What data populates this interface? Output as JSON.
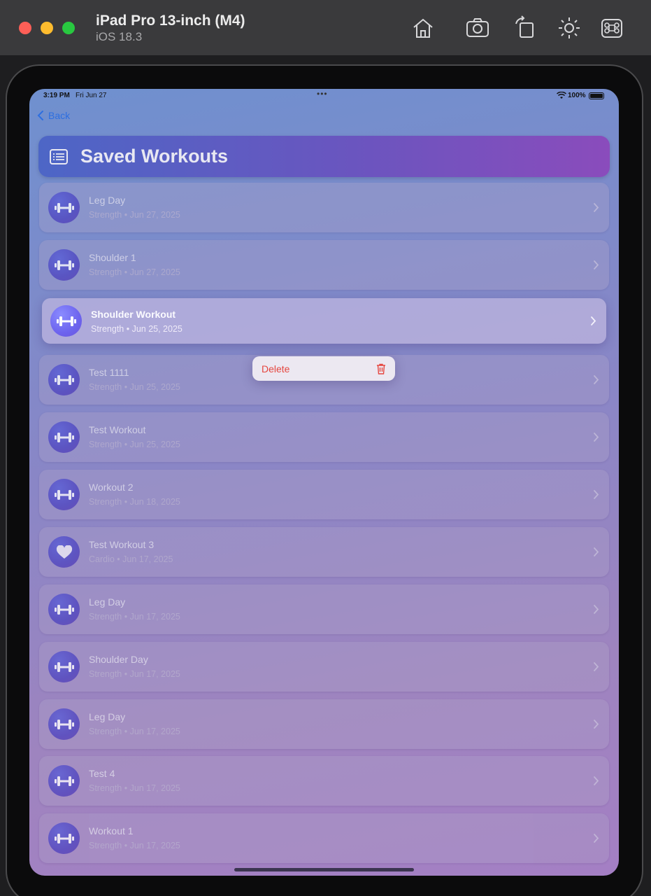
{
  "simulator": {
    "title": "iPad Pro 13-inch (M4)",
    "subtitle": "iOS 18.3",
    "toolbar_icons": [
      "home-icon",
      "screenshot-icon",
      "rotate-icon",
      "appearance-icon",
      "command-icon"
    ]
  },
  "status_bar": {
    "time": "3:19 PM",
    "date": "Fri Jun 27",
    "battery": "100%"
  },
  "nav": {
    "back_label": "Back"
  },
  "header": {
    "title": "Saved Workouts",
    "icon": "list-icon"
  },
  "workouts": [
    {
      "name": "Leg Day",
      "meta": "Strength • Jun 27, 2025",
      "icon": "dumbbell-icon"
    },
    {
      "name": "Shoulder 1",
      "meta": "Strength • Jun 27, 2025",
      "icon": "dumbbell-icon"
    },
    {
      "name": "Shoulder Workout",
      "meta": "Strength • Jun 25, 2025",
      "icon": "dumbbell-icon",
      "selected": true
    },
    {
      "name": "Test 1111",
      "meta": "Strength • Jun 25, 2025",
      "icon": "dumbbell-icon"
    },
    {
      "name": "Test Workout",
      "meta": "Strength • Jun 25, 2025",
      "icon": "dumbbell-icon"
    },
    {
      "name": "Workout 2",
      "meta": "Strength • Jun 18, 2025",
      "icon": "dumbbell-icon"
    },
    {
      "name": "Test Workout 3",
      "meta": "Cardio • Jun 17, 2025",
      "icon": "heart-icon"
    },
    {
      "name": "Leg Day",
      "meta": "Strength • Jun 17, 2025",
      "icon": "dumbbell-icon"
    },
    {
      "name": "Shoulder Day",
      "meta": "Strength • Jun 17, 2025",
      "icon": "dumbbell-icon"
    },
    {
      "name": "Leg Day",
      "meta": "Strength • Jun 17, 2025",
      "icon": "dumbbell-icon"
    },
    {
      "name": "Test 4",
      "meta": "Strength • Jun 17, 2025",
      "icon": "dumbbell-icon"
    },
    {
      "name": "Workout 1",
      "meta": "Strength • Jun 17, 2025",
      "icon": "dumbbell-icon"
    }
  ],
  "context_menu": {
    "delete_label": "Delete",
    "icon": "trash-icon",
    "color": "#e5463f"
  },
  "colors": {
    "accent": "#2d6fe0",
    "header_start": "#4d66c6",
    "header_end": "#8a4cbc"
  }
}
